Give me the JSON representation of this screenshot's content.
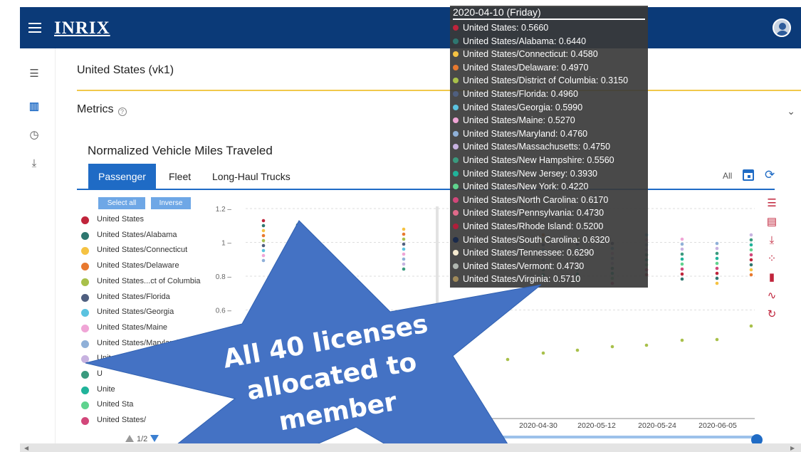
{
  "app": {
    "logo": "INRIX"
  },
  "page": {
    "title": "United States (vk1)",
    "metrics_label": "Metrics",
    "help": "?",
    "section_title": "Normalized Vehicle Miles Traveled"
  },
  "tabs": [
    {
      "label": "Passenger",
      "active": true
    },
    {
      "label": "Fleet"
    },
    {
      "label": "Long-Haul Trucks"
    }
  ],
  "toolbar": {
    "all_label": "All"
  },
  "buttons": {
    "select_all": "Select all",
    "inverse": "Inverse"
  },
  "legend": [
    {
      "label": "United States",
      "color": "#c0243b"
    },
    {
      "label": "United States/Alabama",
      "color": "#2e7770"
    },
    {
      "label": "United States/Connecticut",
      "color": "#f5c242"
    },
    {
      "label": "United States/Delaware",
      "color": "#e8792f"
    },
    {
      "label": "United States...ct of Columbia",
      "color": "#a8c04a"
    },
    {
      "label": "United States/Florida",
      "color": "#4f5f7f"
    },
    {
      "label": "United States/Georgia",
      "color": "#5bc3e0"
    },
    {
      "label": "United States/Maine",
      "color": "#f0a5d6"
    },
    {
      "label": "United States/Maryland",
      "color": "#8fb0d8"
    },
    {
      "label": "United States/M",
      "color": "#c7b2e0"
    },
    {
      "label": "U",
      "color": "#3a9a7e"
    },
    {
      "label": "Unite",
      "color": "#20b39a"
    },
    {
      "label": "United Sta",
      "color": "#5fd38e"
    },
    {
      "label": "United States/",
      "color": "#d2477a"
    }
  ],
  "pager": {
    "text": "1/2"
  },
  "tooltip": {
    "title": "2020-04-10 (Friday)",
    "rows": [
      {
        "text": "United States: 0.5660",
        "color": "#c0243b"
      },
      {
        "text": "United States/Alabama: 0.6440",
        "color": "#2e7770"
      },
      {
        "text": "United States/Connecticut: 0.4580",
        "color": "#f5c242"
      },
      {
        "text": "United States/Delaware: 0.4970",
        "color": "#e8792f"
      },
      {
        "text": "United States/District of Columbia: 0.3150",
        "color": "#a8c04a"
      },
      {
        "text": "United States/Florida: 0.4960",
        "color": "#4f5f7f"
      },
      {
        "text": "United States/Georgia: 0.5990",
        "color": "#5bc3e0"
      },
      {
        "text": "United States/Maine: 0.5270",
        "color": "#f0a5d6"
      },
      {
        "text": "United States/Maryland: 0.4760",
        "color": "#8fb0d8"
      },
      {
        "text": "United States/Massachusetts: 0.4750",
        "color": "#c7b2e0"
      },
      {
        "text": "United States/New Hampshire: 0.5560",
        "color": "#3a9a7e"
      },
      {
        "text": "United States/New Jersey: 0.3930",
        "color": "#20b39a"
      },
      {
        "text": "United States/New York: 0.4220",
        "color": "#5fd38e"
      },
      {
        "text": "United States/North Carolina: 0.6170",
        "color": "#d2477a"
      },
      {
        "text": "United States/Pennsylvania: 0.4730",
        "color": "#e06a8a"
      },
      {
        "text": "United States/Rhode Island: 0.5200",
        "color": "#b01e3a"
      },
      {
        "text": "United States/South Carolina: 0.6320",
        "color": "#1a2a4a"
      },
      {
        "text": "United States/Tennessee: 0.6290",
        "color": "#f5ead0"
      },
      {
        "text": "United States/Vermont: 0.4730",
        "color": "#b0b7b0"
      },
      {
        "text": "United States/Virginia: 0.5710",
        "color": "#a08a5a"
      }
    ]
  },
  "chart_data": {
    "type": "scatter",
    "yticks": [
      "1.2",
      "1",
      "0.8",
      "0.6"
    ],
    "xticks": [
      "2020-04-30",
      "2020-05-12",
      "2020-05-24",
      "2020-06-05"
    ]
  },
  "overlay": {
    "lines": [
      "All 40 licenses",
      "allocated to",
      "member"
    ],
    "color": "#4472c4"
  }
}
